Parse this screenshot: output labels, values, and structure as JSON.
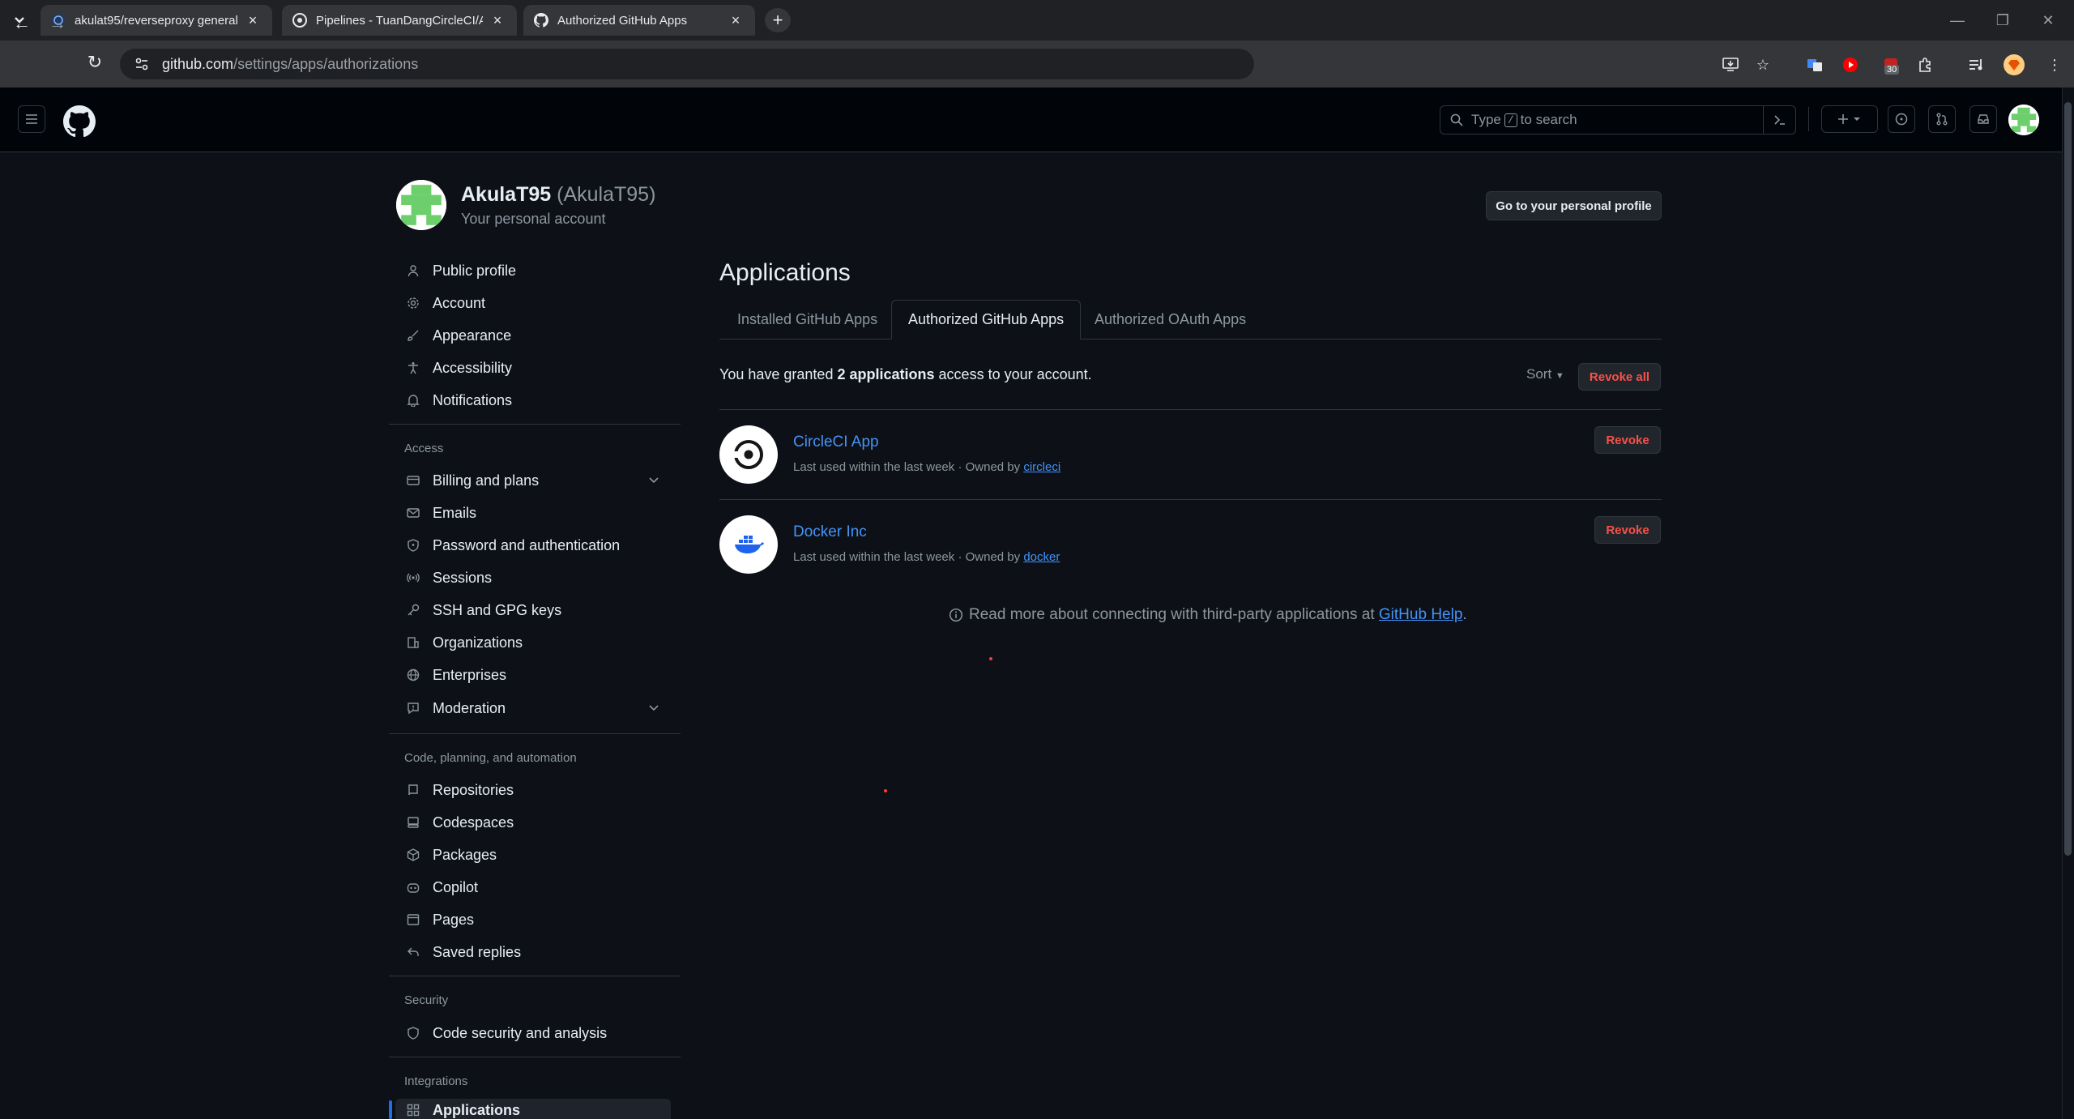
{
  "browser": {
    "tabs": [
      {
        "title": "akulat95/reverseproxy general |",
        "active": false
      },
      {
        "title": "Pipelines - TuanDangCircleCI/A",
        "active": false
      },
      {
        "title": "Authorized GitHub Apps",
        "active": true
      }
    ],
    "url_host": "github.com",
    "url_path": "/settings/apps/authorizations",
    "extension_badge": "30"
  },
  "header": {
    "search_placeholder_before": "Type",
    "search_key": "/",
    "search_placeholder_after": "to search"
  },
  "account": {
    "name": "AkulaT95",
    "login": "(AkulaT95)",
    "subtitle": "Your personal account",
    "go_profile_label": "Go to your personal profile"
  },
  "sidebar": {
    "top_items": [
      {
        "label": "Public profile",
        "icon": "person-icon"
      },
      {
        "label": "Account",
        "icon": "gear-icon"
      },
      {
        "label": "Appearance",
        "icon": "paintbrush-icon"
      },
      {
        "label": "Accessibility",
        "icon": "accessibility-icon"
      },
      {
        "label": "Notifications",
        "icon": "bell-icon"
      }
    ],
    "access_heading": "Access",
    "access_items": [
      {
        "label": "Billing and plans",
        "icon": "credit-card-icon",
        "expandable": true
      },
      {
        "label": "Emails",
        "icon": "mail-icon"
      },
      {
        "label": "Password and authentication",
        "icon": "shield-lock-icon"
      },
      {
        "label": "Sessions",
        "icon": "broadcast-icon"
      },
      {
        "label": "SSH and GPG keys",
        "icon": "key-icon"
      },
      {
        "label": "Organizations",
        "icon": "organization-icon"
      },
      {
        "label": "Enterprises",
        "icon": "globe-icon"
      },
      {
        "label": "Moderation",
        "icon": "report-icon",
        "expandable": true
      }
    ],
    "code_heading": "Code, planning, and automation",
    "code_items": [
      {
        "label": "Repositories",
        "icon": "repo-icon"
      },
      {
        "label": "Codespaces",
        "icon": "codespaces-icon"
      },
      {
        "label": "Packages",
        "icon": "package-icon"
      },
      {
        "label": "Copilot",
        "icon": "copilot-icon"
      },
      {
        "label": "Pages",
        "icon": "browser-icon"
      },
      {
        "label": "Saved replies",
        "icon": "reply-icon"
      }
    ],
    "security_heading": "Security",
    "security_items": [
      {
        "label": "Code security and analysis",
        "icon": "shield-check-icon"
      }
    ],
    "integrations_heading": "Integrations",
    "integrations_items": [
      {
        "label": "Applications",
        "icon": "apps-icon",
        "selected": true
      }
    ]
  },
  "main": {
    "title": "Applications",
    "tabs": [
      {
        "label": "Installed GitHub Apps",
        "active": false
      },
      {
        "label": "Authorized GitHub Apps",
        "active": true
      },
      {
        "label": "Authorized OAuth Apps",
        "active": false
      }
    ],
    "granted_prefix": "You have granted",
    "granted_count": "2 applications",
    "granted_suffix": "access to your account.",
    "sort_label": "Sort",
    "revoke_all_label": "Revoke all",
    "apps": [
      {
        "name": "CircleCI App",
        "meta": "Last used within the last week · Owned by",
        "owner": "circleci",
        "revoke_label": "Revoke",
        "icon": "circleci-logo"
      },
      {
        "name": "Docker Inc",
        "meta": "Last used within the last week · Owned by",
        "owner": "docker",
        "revoke_label": "Revoke",
        "icon": "docker-logo"
      }
    ],
    "help_text": "Read more about connecting with third-party applications at",
    "help_link": "GitHub Help",
    "help_end": "."
  }
}
